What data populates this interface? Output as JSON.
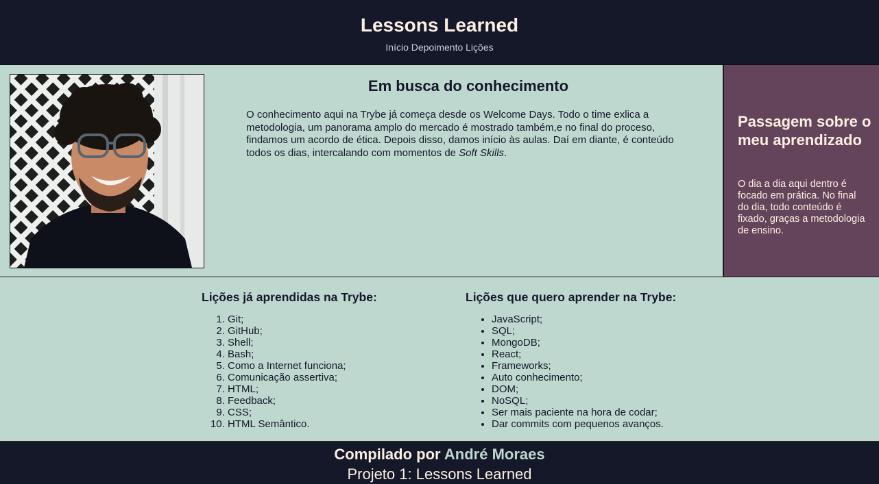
{
  "header": {
    "title": "Lessons Learned",
    "nav": [
      "Início",
      "Depoimento",
      "Lições"
    ]
  },
  "article": {
    "title": "Em busca do conhecimento",
    "paragraph_before": "O conhecimento aqui na Trybe já começa desde os Welcome Days. Todo o time exlica a metodologia, um panorama amplo do mercado é mostrado também,e no final do proceso, findamos um acordo de ética. Depois disso, damos início às aulas. Daí em diante, é conteúdo todos os dias, intercalando com momentos de ",
    "paragraph_em": "Soft Skills",
    "paragraph_after": "."
  },
  "aside": {
    "title": "Passagem sobre o meu aprendizado",
    "text": "O dia a dia aqui dentro é focado em prática. No final do dia, todo conteúdo é fixado, graças a metodologia de ensino."
  },
  "lessons": {
    "learned_title": "Lições já aprendidas na Trybe:",
    "learned": [
      "Git;",
      "GitHub;",
      "Shell;",
      "Bash;",
      "Como a Internet funciona;",
      "Comunicação assertiva;",
      "HTML;",
      "Feedback;",
      "CSS;",
      "HTML Semântico."
    ],
    "wanted_title": "Lições que quero aprender na Trybe:",
    "wanted": [
      "JavaScript;",
      "SQL;",
      "MongoDB;",
      "React;",
      "Frameworks;",
      "Auto conhecimento;",
      "DOM;",
      "NoSQL;",
      "Ser mais paciente na hora de codar;",
      "Dar commits com pequenos avanços."
    ]
  },
  "footer": {
    "credit_prefix": "Compilado por ",
    "author": "André Moraes",
    "project": "Projeto 1: Lessons Learned"
  },
  "colors": {
    "header_bg": "#141829",
    "body_bg": "#bed8d0",
    "aside_bg": "#64445a",
    "heading_light": "#fbefe1"
  }
}
